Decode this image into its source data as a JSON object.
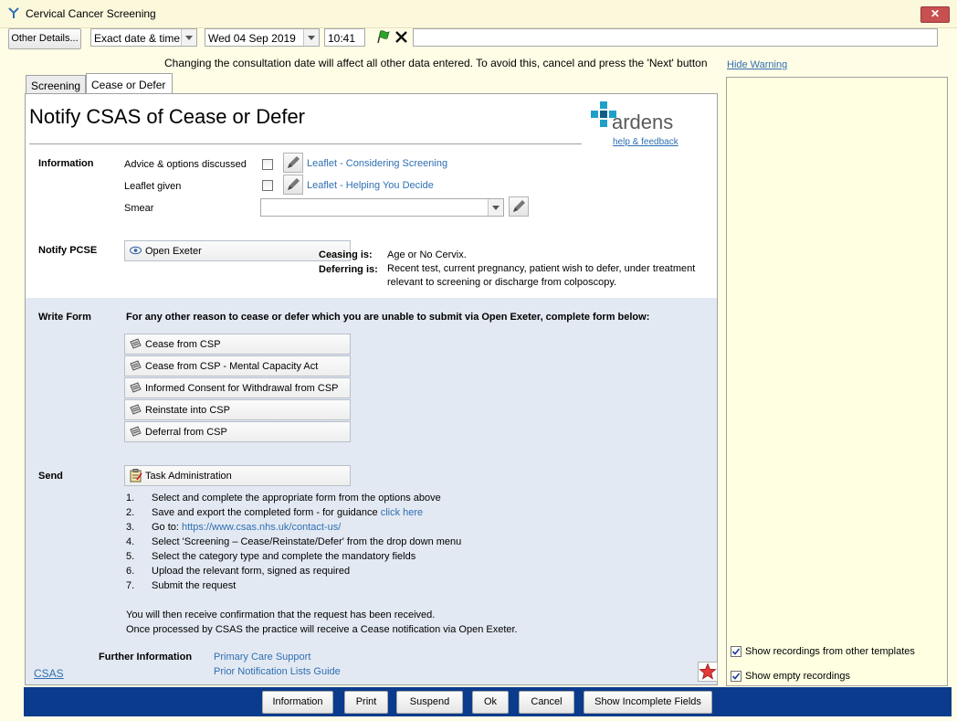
{
  "window": {
    "title": "Cervical Cancer Screening",
    "close_label": "✕"
  },
  "toolbar": {
    "other_details": "Other Details...",
    "date_mode": "Exact date & time",
    "date": "Wed 04 Sep 2019",
    "time": "10:41",
    "free_text": ""
  },
  "warning": {
    "text": "Changing the consultation date will affect all other data entered. To avoid this, cancel and press the 'Next' button",
    "hide_label": "Hide Warning"
  },
  "tabs": [
    {
      "label": "Screening"
    },
    {
      "label": "Cease or Defer"
    }
  ],
  "page": {
    "title": "Notify CSAS of Cease or Defer",
    "brand": "ardens",
    "help_link": "help & feedback"
  },
  "information": {
    "heading": "Information",
    "advice_label": "Advice & options discussed",
    "advice_link": "Leaflet - Considering Screening",
    "leaflet_label": "Leaflet given",
    "leaflet_link": "Leaflet - Helping You Decide",
    "smear_label": "Smear",
    "smear_value": ""
  },
  "notify": {
    "heading": "Notify PCSE",
    "button": "Open Exeter",
    "ceasing_label": "Ceasing is:",
    "ceasing_text": "Age or No Cervix.",
    "deferring_label": "Deferring is:",
    "deferring_text_1": "Recent test, current pregnancy, patient wish to defer, under treatment",
    "deferring_text_2": "relevant to screening or discharge from colposcopy."
  },
  "write_form": {
    "heading": "Write Form",
    "instruction": "For any other reason to cease or defer which you are unable to submit via Open Exeter, complete form below:",
    "forms": [
      "Cease from CSP",
      "Cease from CSP - Mental Capacity Act",
      "Informed Consent for Withdrawal from CSP",
      "Reinstate into CSP",
      "Deferral from CSP"
    ]
  },
  "send": {
    "heading": "Send",
    "button": "Task Administration",
    "steps": [
      {
        "n": "1.",
        "text": "Select and complete the appropriate form from the options above"
      },
      {
        "n": "2.",
        "text": "Save and export the completed form - for guidance ",
        "link": "click here"
      },
      {
        "n": "3.",
        "text": "Go to: ",
        "link": "https://www.csas.nhs.uk/contact-us/"
      },
      {
        "n": "4.",
        "text": "Select 'Screening – Cease/Reinstate/Defer' from the drop down menu"
      },
      {
        "n": "5.",
        "text": "Select the category type and complete the mandatory fields"
      },
      {
        "n": "6.",
        "text": "Upload the relevant form, signed as required"
      },
      {
        "n": "7.",
        "text": "Submit the request"
      }
    ],
    "confirm_1": "You will then receive confirmation that the request has been received.",
    "confirm_2": "Once processed by CSAS the practice will receive a Cease notification via Open Exeter."
  },
  "further": {
    "heading": "Further Information",
    "link_1": "Primary Care Support",
    "link_2": "Prior Notification Lists Guide",
    "csas_link": "CSAS"
  },
  "right_panel": {
    "show_other": "Show recordings from other templates",
    "show_empty": "Show empty recordings"
  },
  "buttons": {
    "information": "Information",
    "print": "Print",
    "suspend": "Suspend",
    "ok": "Ok",
    "cancel": "Cancel",
    "show_incomplete": "Show Incomplete Fields"
  },
  "colors": {
    "accent": "#2f6fb3",
    "brand": "#1fa0c8",
    "bottom_bar": "#0a3b8c",
    "close": "#c75050"
  }
}
